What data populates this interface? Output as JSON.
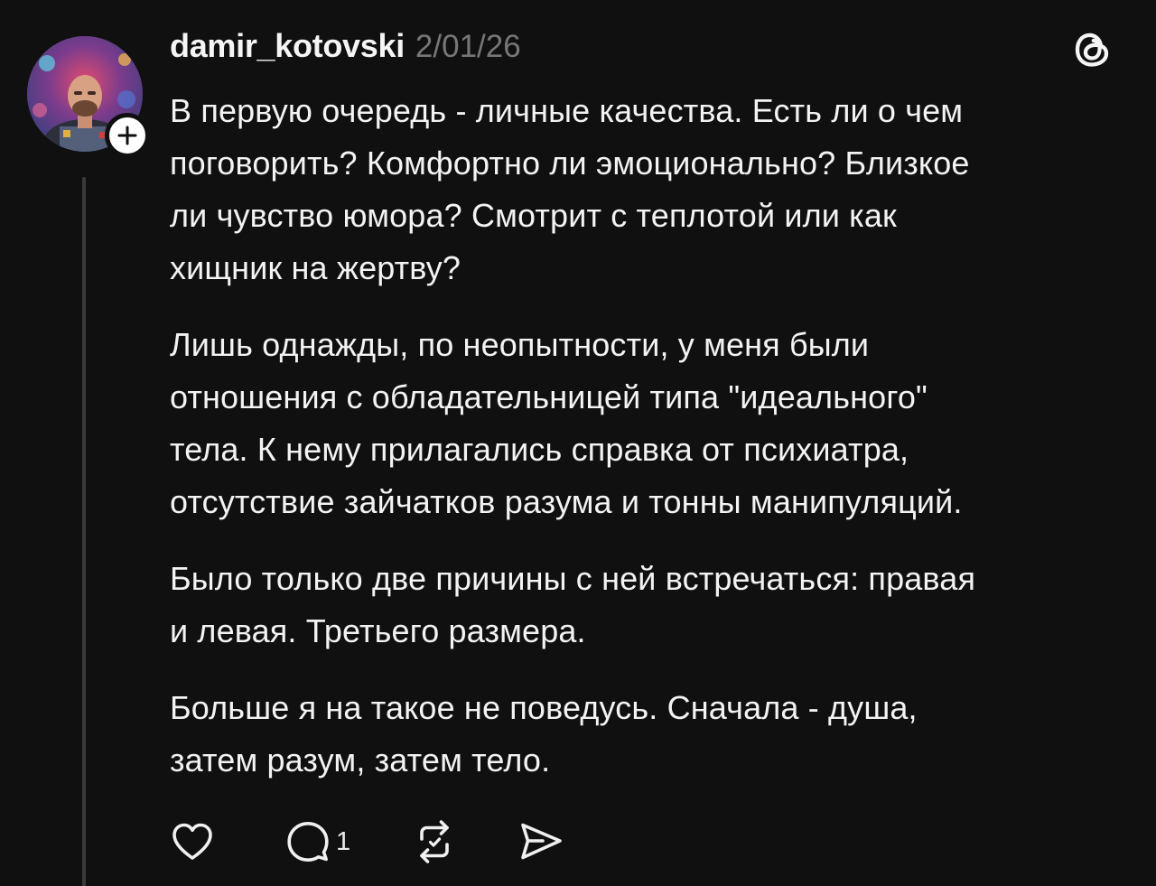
{
  "post": {
    "author": {
      "username": "damir_kotovski",
      "avatar_icon": "profile-photo",
      "follow_icon": "plus-icon"
    },
    "timestamp": "2/01/26",
    "app_icon": "threads-logo-icon",
    "paragraphs": [
      {
        "lines": [
          "В первую очередь - личные качества. Есть ли о чем",
          "поговорить? Комфортно ли эмоционально? Близкое",
          "ли чувство юмора? Смотрит с теплотой или как",
          "хищник на жертву?"
        ]
      },
      {
        "lines": [
          "Лишь однажды, по неопытности, у меня были",
          "отношения с обладательницей  типа \"идеального\"",
          "тела. К нему прилагались справка от психиатра,",
          "отсутствие зайчатков разума и тонны манипуляций."
        ]
      },
      {
        "lines": [
          "Было только две причины с ней встречаться: правая",
          "и левая. Третьего размера."
        ]
      },
      {
        "lines": [
          "Больше я на такое не поведусь. Сначала - душа,",
          "затем разум, затем тело."
        ]
      }
    ],
    "actions": {
      "like_icon": "heart-icon",
      "reply_icon": "comment-icon",
      "reply_count": "1",
      "repost_icon": "repost-icon",
      "share_icon": "send-icon"
    }
  },
  "colors": {
    "background": "#101010",
    "text": "#f3f3f3",
    "muted": "#777777",
    "thread_line": "#3a3a3a"
  }
}
